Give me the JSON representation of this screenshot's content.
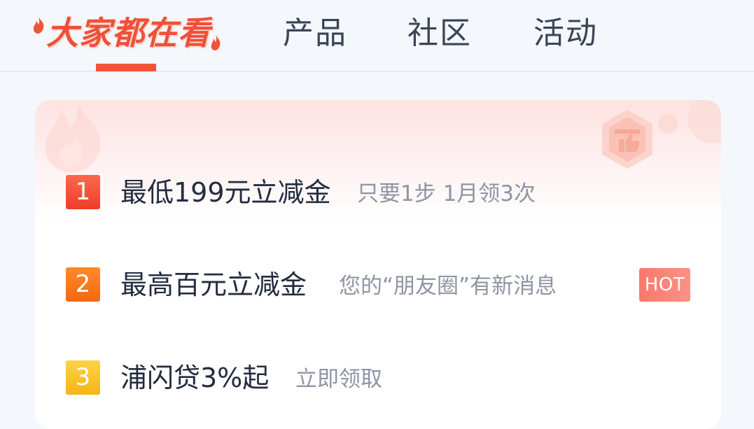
{
  "tabs": [
    {
      "label": "大家都在看",
      "active": true
    },
    {
      "label": "产品",
      "active": false
    },
    {
      "label": "社区",
      "active": false
    },
    {
      "label": "活动",
      "active": false
    }
  ],
  "items": [
    {
      "rank": "1",
      "title": "最低199元立减金",
      "subtitle": "只要1步 1月领3次"
    },
    {
      "rank": "2",
      "title": "最高百元立减金",
      "subtitle": "您的“朋友圈”有新消息",
      "badge": "HOT"
    },
    {
      "rank": "3",
      "title": "浦闪贷3%起",
      "subtitle": "立即领取"
    }
  ],
  "colors": {
    "accent": "#f05436",
    "rank_1": "#f3503a",
    "rank_2": "#f87a1e",
    "rank_3": "#f9c22e",
    "hot_badge": "#f9857a",
    "title_text": "#232c3f",
    "subtitle_text": "#8e95a3",
    "tab_text": "#3b4456"
  },
  "icons": {
    "logo_flames": "flame-icon",
    "card_badge": "thumbs-up-badge-icon"
  }
}
